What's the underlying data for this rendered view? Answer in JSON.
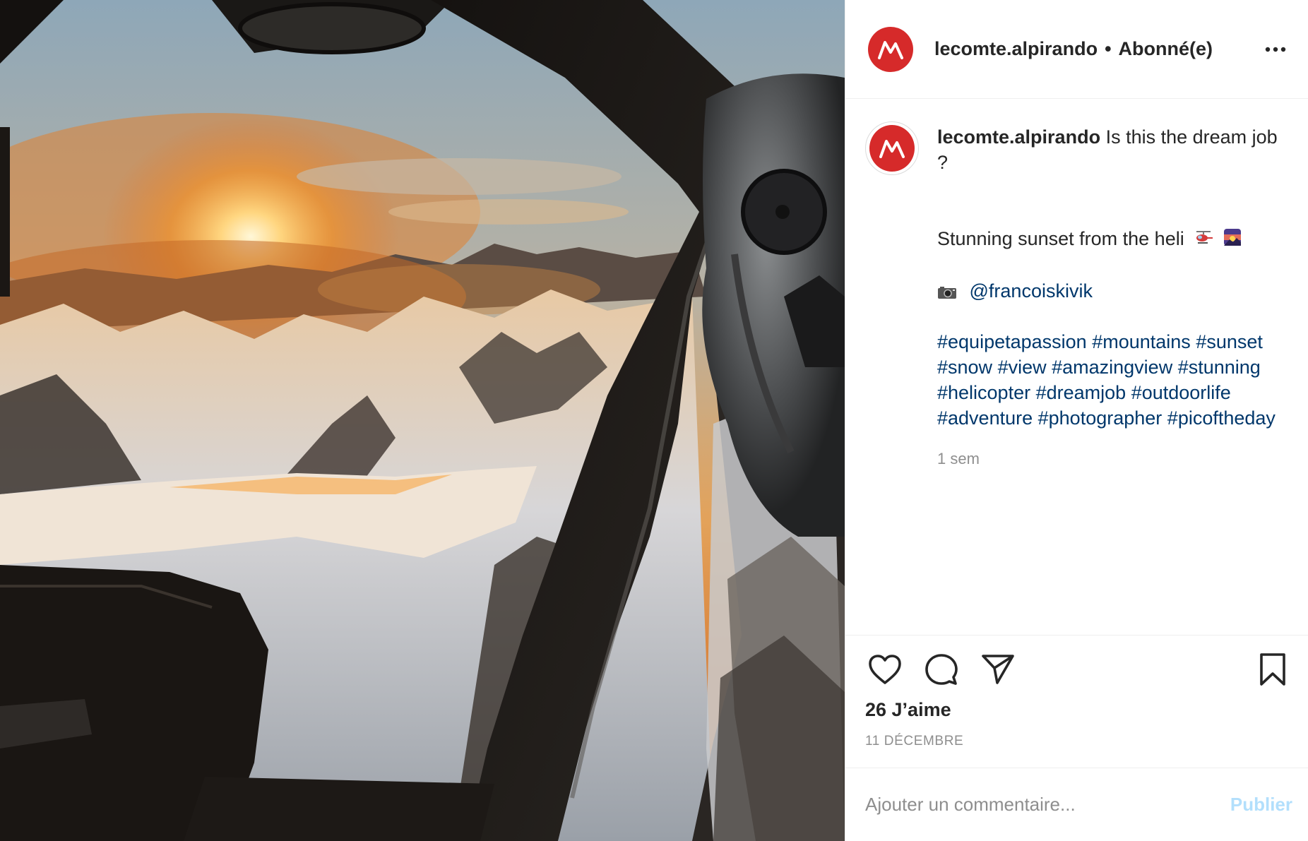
{
  "post": {
    "account": {
      "username": "lecomte.alpirando",
      "separator": "•",
      "follow_state": "Abonné(e)",
      "avatar_color": "#d62a2a"
    },
    "caption": {
      "username": "lecomte.alpirando",
      "first_line": "Is this the dream job ?",
      "line2": "Stunning sunset from the heli",
      "line2_emojis": [
        "helicopter-emoji",
        "sunset-emoji"
      ],
      "photo_credit_icon": "camera-emoji",
      "mention": "@francoiskivik",
      "hashtags": [
        "#equipetapassion",
        "#mountains",
        "#sunset",
        "#snow",
        "#view",
        "#amazingview",
        "#stunning",
        "#helicopter",
        "#dreamjob",
        "#outdoorlife",
        "#adventure",
        "#photographer",
        "#picoftheday"
      ],
      "time_ago": "1 sem"
    },
    "actions": {
      "like_icon": "heart-icon",
      "comment_icon": "comment-bubble-icon",
      "share_icon": "paper-plane-icon",
      "save_icon": "bookmark-icon"
    },
    "likes": "26 J’aime",
    "date": "11 DÉCEMBRE",
    "comment": {
      "placeholder": "Ajouter un commentaire...",
      "publish_label": "Publier",
      "publish_color": "#b2dffc"
    },
    "more_icon": "more-options-icon"
  }
}
